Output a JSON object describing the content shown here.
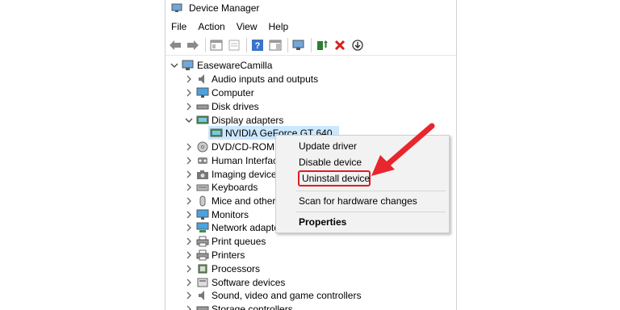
{
  "window": {
    "title": "Device Manager"
  },
  "menu": [
    "File",
    "Action",
    "View",
    "Help"
  ],
  "toolbar": {
    "buttons": [
      "back-arrow-icon",
      "forward-arrow-icon",
      "properties-pane-icon",
      "show-hidden-icon",
      "help-icon",
      "action-pane-icon",
      "scan-hardware-icon",
      "update-driver-icon",
      "uninstall-x-icon",
      "download-icon"
    ]
  },
  "tree": {
    "root": "EasewareCamilla",
    "items": [
      {
        "label": "Audio inputs and outputs",
        "icon": "speaker-icon"
      },
      {
        "label": "Computer",
        "icon": "monitor-icon"
      },
      {
        "label": "Disk drives",
        "icon": "disk-drive-icon"
      },
      {
        "label": "Display adapters",
        "icon": "display-adapter-icon",
        "expanded": true
      },
      {
        "label": "NVIDIA GeForce GT 640",
        "icon": "display-adapter-icon",
        "child": true,
        "selected": true
      },
      {
        "label": "DVD/CD-ROM d",
        "icon": "dvd-drive-icon"
      },
      {
        "label": "Human Interface",
        "icon": "human-interface-icon"
      },
      {
        "label": "Imaging devices",
        "icon": "camera-icon"
      },
      {
        "label": "Keyboards",
        "icon": "keyboard-icon"
      },
      {
        "label": "Mice and other p",
        "icon": "mouse-icon"
      },
      {
        "label": "Monitors",
        "icon": "monitor-icon"
      },
      {
        "label": "Network adapte",
        "icon": "network-adapter-icon"
      },
      {
        "label": "Print queues",
        "icon": "printer-icon"
      },
      {
        "label": "Printers",
        "icon": "printer-icon"
      },
      {
        "label": "Processors",
        "icon": "processor-icon"
      },
      {
        "label": "Software devices",
        "icon": "software-device-icon"
      },
      {
        "label": "Sound, video and game controllers",
        "icon": "speaker-icon"
      },
      {
        "label": "Storage controllers",
        "icon": "storage-controller-icon"
      }
    ]
  },
  "context_menu": {
    "update": "Update driver",
    "disable": "Disable device",
    "uninstall": "Uninstall device",
    "scan": "Scan for hardware changes",
    "properties": "Properties"
  },
  "colors": {
    "highlight": "#e01b24",
    "selection": "#cce8ff",
    "arrow": "#e8262d"
  }
}
